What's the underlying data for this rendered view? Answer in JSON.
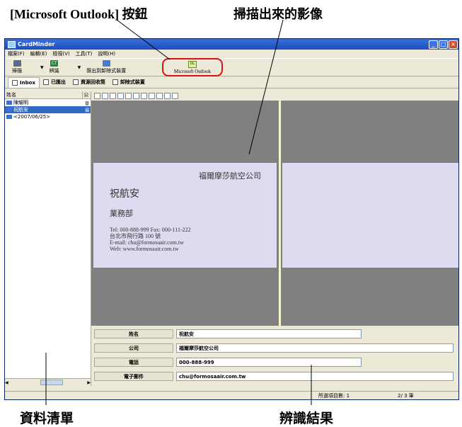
{
  "callouts": {
    "outlook": "[Microsoft Outlook] 按鈕",
    "scan": "掃描出來的影像",
    "list": "資料清單",
    "result": "辨識結果"
  },
  "window": {
    "title": "CardMinder"
  },
  "menu": [
    "檔案(F)",
    "編輯(E)",
    "檢視(V)",
    "工具(T)",
    "說明(H)"
  ],
  "toolbar": {
    "scan_label": "掃描",
    "recognize_label": "辨識",
    "export_label": "匯出到卸除式裝置",
    "outlook_label": "Microsoft Outlook"
  },
  "tabs": [
    "Inbox",
    "已匯出",
    "資源回收筒",
    "卸除式裝置"
  ],
  "list": {
    "header": [
      "姓名",
      "公"
    ],
    "rows": [
      {
        "name": "陳耀明",
        "side": "晉"
      },
      {
        "name": "祝航安",
        "side": "福"
      },
      {
        "name": "<2007/06/25>",
        "side": ""
      }
    ]
  },
  "card": {
    "company": "福爾摩莎航空公司",
    "name": "祝航安",
    "dept": "業務部",
    "lines": [
      "Tel: 000-888-999   Fax: 000-111-222",
      "台北市飛行路 100 號",
      "E-mail: chu@formosaair.com.tw",
      "Web: www.formosaair.com.tw"
    ]
  },
  "fields": [
    {
      "label": "姓名",
      "value": "祝航安"
    },
    {
      "label": "公司",
      "value": "福爾摩莎航空公司"
    },
    {
      "label": "電話",
      "value": "000-888-999"
    },
    {
      "label": "電子郵件",
      "value": "chu@formosaair.com.tw"
    }
  ],
  "status": {
    "selected": "所選項目數:  1",
    "page": "2/  3 筆"
  }
}
